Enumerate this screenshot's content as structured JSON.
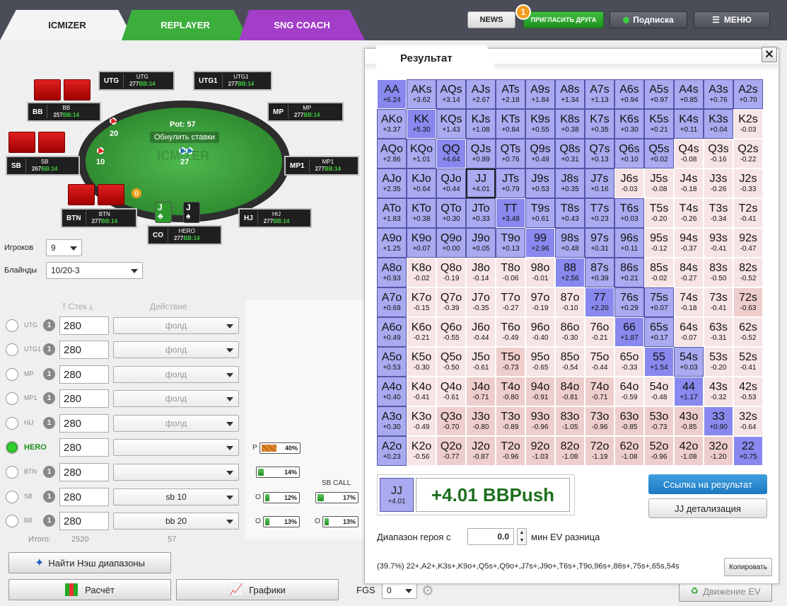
{
  "tabs": [
    {
      "label": "ICMIZER"
    },
    {
      "label": "REPLAYER"
    },
    {
      "label": "SNG COACH"
    }
  ],
  "topbar": {
    "news": "NEWS",
    "invite": "ПРИГЛАСИТЬ ДРУГА",
    "invite_badge": "1",
    "subscription": "Подписка",
    "menu": "МЕНЮ"
  },
  "table": {
    "pot_label": "Pot: 57",
    "reset_bets": "Обнулить ставки",
    "watermark": "ICMIZER",
    "bb_chip": "20",
    "sb_chip": "10",
    "pot_chip": "27",
    "dealer": "D",
    "seats": [
      {
        "pos": "UTG",
        "name": "UTG",
        "stack": "277",
        "bb": "BB:14"
      },
      {
        "pos": "UTG1",
        "name": "UTG1",
        "stack": "277",
        "bb": "BB:14"
      },
      {
        "pos": "BB",
        "name": "BB",
        "stack": "257",
        "bb": "BB:14"
      },
      {
        "pos": "MP",
        "name": "MP",
        "stack": "277",
        "bb": "BB:14"
      },
      {
        "pos": "SB",
        "name": "SB",
        "stack": "267",
        "bb": "BB:14"
      },
      {
        "pos": "MP1",
        "name": "MP1",
        "stack": "277",
        "bb": "BB:14"
      },
      {
        "pos": "BTN",
        "name": "BTN",
        "stack": "277",
        "bb": "BB:14"
      },
      {
        "pos": "HJ",
        "name": "HIJ",
        "stack": "277",
        "bb": "BB:14"
      },
      {
        "pos": "CO",
        "name": "HERO",
        "stack": "277",
        "bb": "BB:14"
      }
    ],
    "hero_cards": [
      {
        "rank": "J",
        "suit": "♣"
      },
      {
        "rank": "J",
        "suit": "♠"
      }
    ]
  },
  "settings": {
    "players_label": "Игроков",
    "players_value": "9",
    "blinds_label": "Блайнды",
    "blinds_value": "10/20-3"
  },
  "columns": {
    "stack": "Стек",
    "action": "Действие"
  },
  "players": [
    {
      "name": "UTG",
      "num": "1",
      "stack": "280",
      "action": "фолд"
    },
    {
      "name": "UTG1",
      "num": "1",
      "stack": "280",
      "action": "фолд"
    },
    {
      "name": "MP",
      "num": "1",
      "stack": "280",
      "action": "фолд"
    },
    {
      "name": "MP1",
      "num": "1",
      "stack": "280",
      "action": "фолд"
    },
    {
      "name": "HIJ",
      "num": "1",
      "stack": "280",
      "action": "фолд"
    },
    {
      "name": "HERO",
      "num": "1",
      "stack": "280",
      "action": ""
    },
    {
      "name": "BTN",
      "num": "1",
      "stack": "280",
      "action": ""
    },
    {
      "name": "SB",
      "num": "1",
      "stack": "280",
      "action": "sb 10"
    },
    {
      "name": "BB",
      "num": "1",
      "stack": "280",
      "action": "bb 20"
    }
  ],
  "totals": {
    "label": "Итого:",
    "stack": "2520",
    "action": "57"
  },
  "probs": {
    "p_label": "P",
    "p_value": "40%",
    "p_fill": 0.4,
    "b1": "14%",
    "b1_fill": 0.14,
    "b2_label": "O",
    "b2": "12%",
    "b2_fill": 0.12,
    "b3_label": "O",
    "b3": "13%",
    "b3_fill": 0.13,
    "sbcall_label": "SB CALL",
    "sbcall": "17%",
    "sbcall_fill": 0.17,
    "b4_label": "O",
    "b4": "13%",
    "b4_fill": 0.13
  },
  "buttons": {
    "nash": "Найти Нэш диапазоны",
    "calc": "Расчёт",
    "graphs": "Графики",
    "fgs_label": "FGS",
    "fgs_value": "0",
    "ev_move": "Движение EV"
  },
  "result": {
    "title": "Результат",
    "close": "✕",
    "selected_hand": "JJ",
    "selected_value": "+4.01",
    "summary": "+4.01 BBPush",
    "link_button": "Ссылка на результат",
    "detail_button": "JJ детализация",
    "range_label_pre": "Диапазон героя с",
    "range_value": "0.0",
    "range_label_post": "мин EV разница",
    "range_text": "(39.7%) 22+,A2+,K3s+,K9o+,Q5s+,Q9o+,J7s+,J9o+,T6s+,T9o,96s+,86s+,75s+,65s,54s",
    "copy_button": "Копировать"
  },
  "matrix": [
    [
      [
        "AA",
        "+6.24",
        "pair"
      ],
      [
        "AKs",
        "+3.62",
        "push"
      ],
      [
        "AQs",
        "+3.14",
        "push"
      ],
      [
        "AJs",
        "+2.67",
        "push"
      ],
      [
        "ATs",
        "+2.18",
        "push"
      ],
      [
        "A9s",
        "+1.84",
        "push"
      ],
      [
        "A8s",
        "+1.34",
        "push"
      ],
      [
        "A7s",
        "+1.13",
        "push"
      ],
      [
        "A6s",
        "+0.94",
        "push"
      ],
      [
        "A5s",
        "+0.97",
        "push"
      ],
      [
        "A4s",
        "+0.85",
        "push"
      ],
      [
        "A3s",
        "+0.76",
        "push"
      ],
      [
        "A2s",
        "+0.70",
        "push"
      ]
    ],
    [
      [
        "AKo",
        "+3.37",
        "push"
      ],
      [
        "KK",
        "+5.30",
        "pair"
      ],
      [
        "KQs",
        "+1.43",
        "push"
      ],
      [
        "KJs",
        "+1.08",
        "push"
      ],
      [
        "KTs",
        "+0.84",
        "push"
      ],
      [
        "K9s",
        "+0.55",
        "push"
      ],
      [
        "K8s",
        "+0.38",
        "push"
      ],
      [
        "K7s",
        "+0.35",
        "push"
      ],
      [
        "K6s",
        "+0.30",
        "push"
      ],
      [
        "K5s",
        "+0.21",
        "push"
      ],
      [
        "K4s",
        "+0.11",
        "push"
      ],
      [
        "K3s",
        "+0.04",
        "push"
      ],
      [
        "K2s",
        "-0.03",
        "fold"
      ]
    ],
    [
      [
        "AQo",
        "+2.86",
        "push"
      ],
      [
        "KQo",
        "+1.01",
        "push"
      ],
      [
        "QQ",
        "+4.64",
        "pair"
      ],
      [
        "QJs",
        "+0.89",
        "push"
      ],
      [
        "QTs",
        "+0.76",
        "push"
      ],
      [
        "Q9s",
        "+0.49",
        "push"
      ],
      [
        "Q8s",
        "+0.31",
        "push"
      ],
      [
        "Q7s",
        "+0.13",
        "push"
      ],
      [
        "Q6s",
        "+0.10",
        "push"
      ],
      [
        "Q5s",
        "+0.02",
        "push"
      ],
      [
        "Q4s",
        "-0.08",
        "fold"
      ],
      [
        "Q3s",
        "-0.16",
        "fold"
      ],
      [
        "Q2s",
        "-0.22",
        "fold"
      ]
    ],
    [
      [
        "AJo",
        "+2.35",
        "push"
      ],
      [
        "KJo",
        "+0.64",
        "push"
      ],
      [
        "QJo",
        "+0.44",
        "push"
      ],
      [
        "JJ",
        "+4.01",
        "sel"
      ],
      [
        "JTs",
        "+0.79",
        "push"
      ],
      [
        "J9s",
        "+0.53",
        "push"
      ],
      [
        "J8s",
        "+0.35",
        "push"
      ],
      [
        "J7s",
        "+0.16",
        "push"
      ],
      [
        "J6s",
        "-0.03",
        "fold"
      ],
      [
        "J5s",
        "-0.08",
        "fold"
      ],
      [
        "J4s",
        "-0.18",
        "fold"
      ],
      [
        "J3s",
        "-0.26",
        "fold"
      ],
      [
        "J2s",
        "-0.33",
        "fold"
      ]
    ],
    [
      [
        "ATo",
        "+1.83",
        "push"
      ],
      [
        "KTo",
        "+0.38",
        "push"
      ],
      [
        "QTo",
        "+0.30",
        "push"
      ],
      [
        "JTo",
        "+0.33",
        "push"
      ],
      [
        "TT",
        "+3.48",
        "pair"
      ],
      [
        "T9s",
        "+0.61",
        "push"
      ],
      [
        "T8s",
        "+0.43",
        "push"
      ],
      [
        "T7s",
        "+0.23",
        "push"
      ],
      [
        "T6s",
        "+0.03",
        "push"
      ],
      [
        "T5s",
        "-0.20",
        "fold"
      ],
      [
        "T4s",
        "-0.26",
        "fold"
      ],
      [
        "T3s",
        "-0.34",
        "fold"
      ],
      [
        "T2s",
        "-0.41",
        "fold"
      ]
    ],
    [
      [
        "A9o",
        "+1.25",
        "push"
      ],
      [
        "K9o",
        "+0.07",
        "push"
      ],
      [
        "Q9o",
        "+0.00",
        "push"
      ],
      [
        "J9o",
        "+0.05",
        "push"
      ],
      [
        "T9o",
        "+0.13",
        "push"
      ],
      [
        "99",
        "+2.96",
        "pair"
      ],
      [
        "98s",
        "+0.48",
        "push"
      ],
      [
        "97s",
        "+0.31",
        "push"
      ],
      [
        "96s",
        "+0.11",
        "push"
      ],
      [
        "95s",
        "-0.12",
        "fold"
      ],
      [
        "94s",
        "-0.37",
        "fold"
      ],
      [
        "93s",
        "-0.41",
        "fold"
      ],
      [
        "92s",
        "-0.47",
        "fold"
      ]
    ],
    [
      [
        "A8o",
        "+0.93",
        "push"
      ],
      [
        "K8o",
        "-0.02",
        "fold"
      ],
      [
        "Q8o",
        "-0.19",
        "fold"
      ],
      [
        "J8o",
        "-0.14",
        "fold"
      ],
      [
        "T8o",
        "-0.06",
        "fold"
      ],
      [
        "98o",
        "-0.01",
        "fold"
      ],
      [
        "88",
        "+2.56",
        "pair"
      ],
      [
        "87s",
        "+0.39",
        "push"
      ],
      [
        "86s",
        "+0.21",
        "push"
      ],
      [
        "85s",
        "-0.02",
        "fold"
      ],
      [
        "84s",
        "-0.27",
        "fold"
      ],
      [
        "83s",
        "-0.50",
        "fold"
      ],
      [
        "82s",
        "-0.52",
        "fold"
      ]
    ],
    [
      [
        "A7o",
        "+0.69",
        "push"
      ],
      [
        "K7o",
        "-0.15",
        "fold"
      ],
      [
        "Q7o",
        "-0.39",
        "fold"
      ],
      [
        "J7o",
        "-0.35",
        "fold"
      ],
      [
        "T7o",
        "-0.27",
        "fold"
      ],
      [
        "97o",
        "-0.19",
        "fold"
      ],
      [
        "87o",
        "-0.10",
        "fold"
      ],
      [
        "77",
        "+2.20",
        "pair"
      ],
      [
        "76s",
        "+0.29",
        "push"
      ],
      [
        "75s",
        "+0.07",
        "push"
      ],
      [
        "74s",
        "-0.18",
        "fold"
      ],
      [
        "73s",
        "-0.41",
        "fold"
      ],
      [
        "72s",
        "-0.63",
        "foldd"
      ]
    ],
    [
      [
        "A6o",
        "+0.49",
        "push"
      ],
      [
        "K6o",
        "-0.21",
        "fold"
      ],
      [
        "Q6o",
        "-0.55",
        "fold"
      ],
      [
        "J6o",
        "-0.44",
        "fold"
      ],
      [
        "T6o",
        "-0.49",
        "fold"
      ],
      [
        "96o",
        "-0.40",
        "fold"
      ],
      [
        "86o",
        "-0.30",
        "fold"
      ],
      [
        "76o",
        "-0.21",
        "fold"
      ],
      [
        "66",
        "+1.87",
        "pair"
      ],
      [
        "65s",
        "+0.17",
        "push"
      ],
      [
        "64s",
        "-0.07",
        "fold"
      ],
      [
        "63s",
        "-0.31",
        "fold"
      ],
      [
        "62s",
        "-0.52",
        "fold"
      ]
    ],
    [
      [
        "A5o",
        "+0.53",
        "push"
      ],
      [
        "K5o",
        "-0.30",
        "fold"
      ],
      [
        "Q5o",
        "-0.50",
        "fold"
      ],
      [
        "J5o",
        "-0.61",
        "fold"
      ],
      [
        "T5o",
        "-0.73",
        "foldd"
      ],
      [
        "95o",
        "-0.65",
        "fold"
      ],
      [
        "85o",
        "-0.54",
        "fold"
      ],
      [
        "75o",
        "-0.44",
        "fold"
      ],
      [
        "65o",
        "-0.33",
        "fold"
      ],
      [
        "55",
        "+1.54",
        "pair"
      ],
      [
        "54s",
        "+0.03",
        "push"
      ],
      [
        "53s",
        "-0.20",
        "fold"
      ],
      [
        "52s",
        "-0.41",
        "fold"
      ]
    ],
    [
      [
        "A4o",
        "+0.40",
        "push"
      ],
      [
        "K4o",
        "-0.41",
        "fold"
      ],
      [
        "Q4o",
        "-0.61",
        "fold"
      ],
      [
        "J4o",
        "-0.71",
        "foldd"
      ],
      [
        "T4o",
        "-0.80",
        "foldd"
      ],
      [
        "94o",
        "-0.91",
        "foldd"
      ],
      [
        "84o",
        "-0.81",
        "foldd"
      ],
      [
        "74o",
        "-0.71",
        "foldd"
      ],
      [
        "64o",
        "-0.59",
        "fold"
      ],
      [
        "54o",
        "-0.48",
        "fold"
      ],
      [
        "44",
        "+1.17",
        "pair"
      ],
      [
        "43s",
        "-0.32",
        "fold"
      ],
      [
        "42s",
        "-0.53",
        "fold"
      ]
    ],
    [
      [
        "A3o",
        "+0.30",
        "push"
      ],
      [
        "K3o",
        "-0.49",
        "fold"
      ],
      [
        "Q3o",
        "-0.70",
        "foldd"
      ],
      [
        "J3o",
        "-0.80",
        "foldd"
      ],
      [
        "T3o",
        "-0.89",
        "foldd"
      ],
      [
        "93o",
        "-0.96",
        "foldd"
      ],
      [
        "83o",
        "-1.05",
        "foldd"
      ],
      [
        "73o",
        "-0.96",
        "foldd"
      ],
      [
        "63o",
        "-0.85",
        "foldd"
      ],
      [
        "53o",
        "-0.73",
        "foldd"
      ],
      [
        "43o",
        "-0.85",
        "foldd"
      ],
      [
        "33",
        "+0.90",
        "pair"
      ],
      [
        "32s",
        "-0.64",
        "fold"
      ]
    ],
    [
      [
        "A2o",
        "+0.23",
        "push"
      ],
      [
        "K2o",
        "-0.56",
        "fold"
      ],
      [
        "Q2o",
        "-0.77",
        "foldd"
      ],
      [
        "J2o",
        "-0.87",
        "foldd"
      ],
      [
        "T2o",
        "-0.96",
        "foldd"
      ],
      [
        "92o",
        "-1.03",
        "foldd"
      ],
      [
        "82o",
        "-1.08",
        "foldd"
      ],
      [
        "72o",
        "-1.19",
        "foldd"
      ],
      [
        "62o",
        "-1.08",
        "foldd"
      ],
      [
        "52o",
        "-0.96",
        "foldd"
      ],
      [
        "42o",
        "-1.08",
        "foldd"
      ],
      [
        "32o",
        "-1.20",
        "foldd"
      ],
      [
        "22",
        "+0.75",
        "pair"
      ]
    ]
  ]
}
